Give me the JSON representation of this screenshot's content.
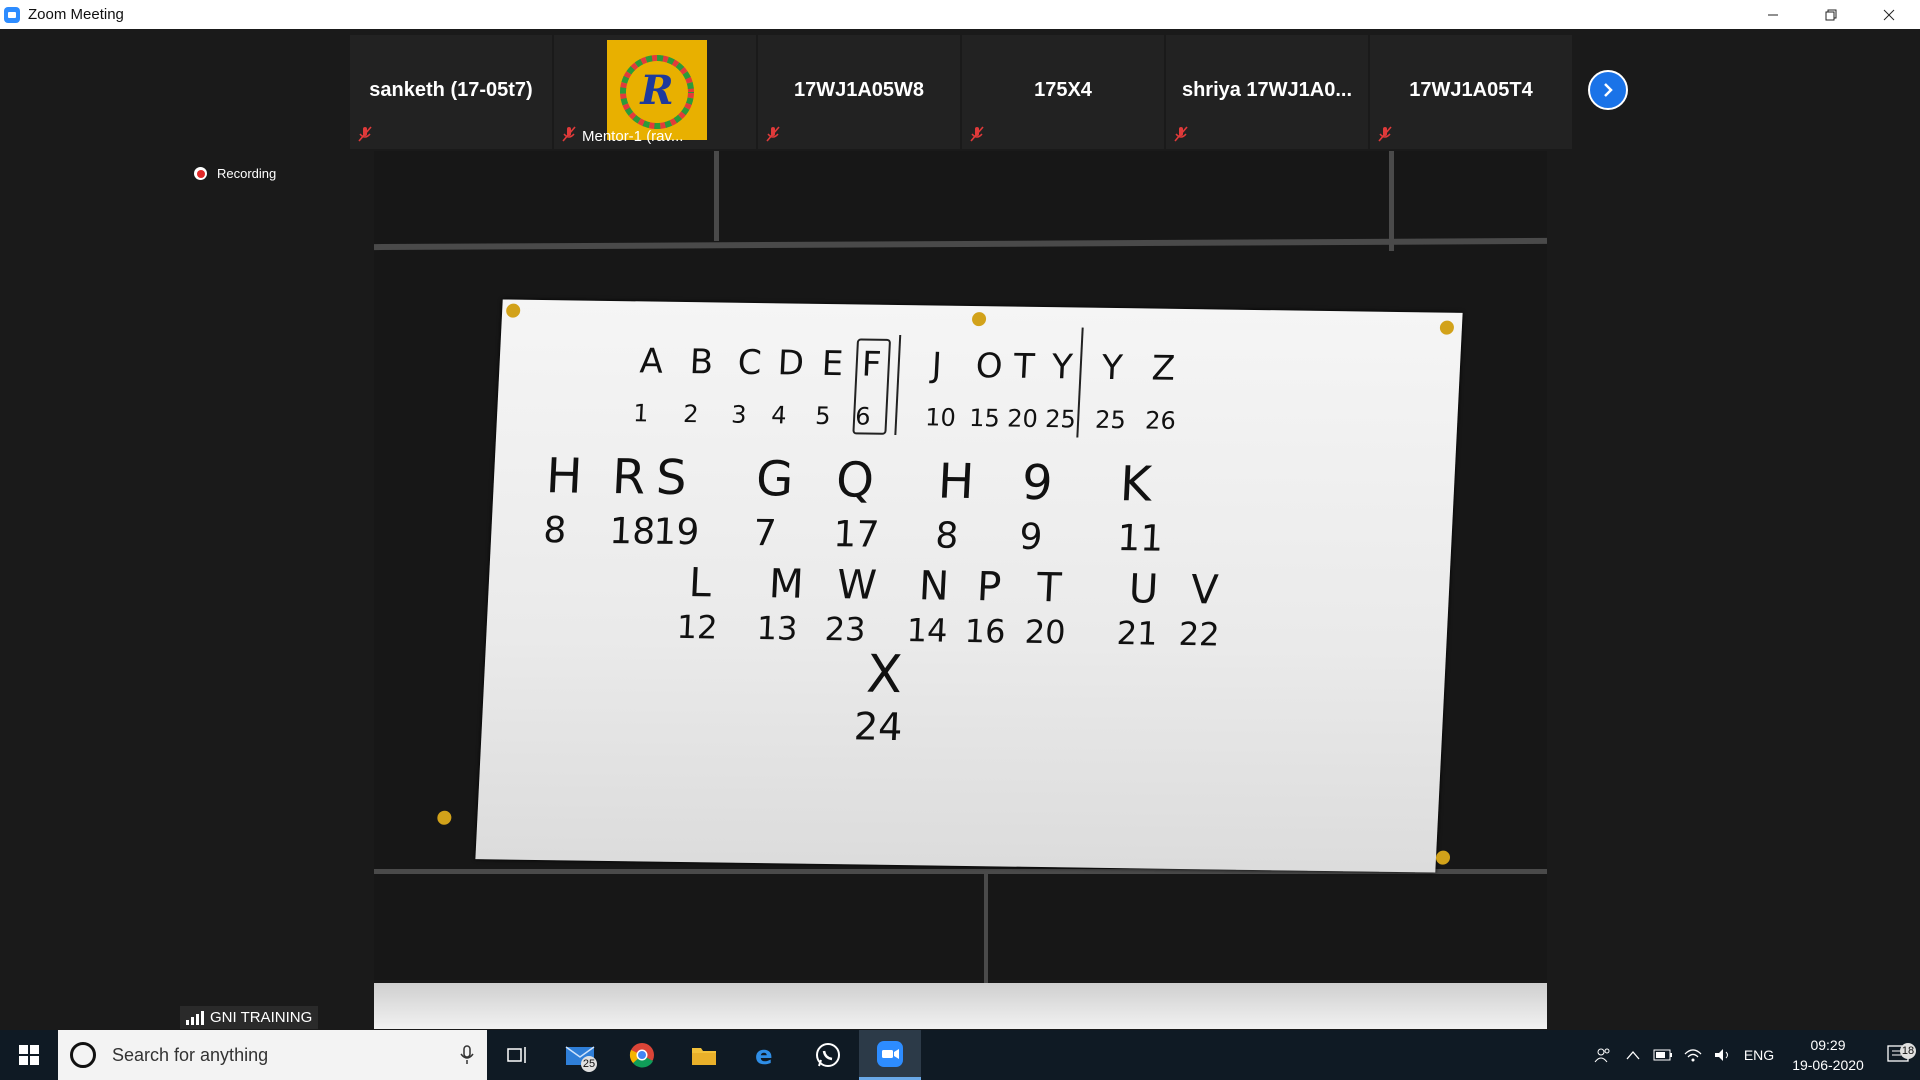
{
  "window": {
    "title": "Zoom Meeting"
  },
  "participants": [
    {
      "name": "sanketh (17-05t7)",
      "muted": true
    },
    {
      "name": "Mentor-1 (rav...",
      "muted": true,
      "has_picture": true,
      "picture_letter": "R"
    },
    {
      "name": "17WJ1A05W8",
      "muted": true
    },
    {
      "name": "175X4",
      "muted": true
    },
    {
      "name": "shriya  17WJ1A0...",
      "muted": true
    },
    {
      "name": "17WJ1A05T4",
      "muted": true
    }
  ],
  "recording": {
    "label": "Recording"
  },
  "shared_video": {
    "board": {
      "row1_letters": [
        "A",
        "B",
        "C",
        "D",
        "E",
        "F",
        "J",
        "O",
        "T",
        "Y",
        "Y",
        "Z"
      ],
      "row1_numbers": [
        "1",
        "2",
        "3",
        "4",
        "5",
        "6",
        "10",
        "15",
        "20",
        "25",
        "25",
        "26"
      ],
      "row2_letters": [
        "H",
        "R",
        "S",
        "G",
        "Q",
        "H",
        "9",
        "K"
      ],
      "row2_numbers": [
        "8",
        "18",
        "19",
        "7",
        "17",
        "8",
        "9",
        "11"
      ],
      "row3_letters": [
        "L",
        "M",
        "W",
        "N",
        "P",
        "T",
        "U",
        "V"
      ],
      "row3_numbers": [
        "12",
        "13",
        "23",
        "14",
        "16",
        "20",
        "21",
        "22"
      ],
      "row4_letter": "X",
      "row4_number": "24"
    }
  },
  "network": {
    "label": "GNI TRAINING"
  },
  "taskbar": {
    "search_placeholder": "Search for anything",
    "mail_badge": "25",
    "language": "ENG",
    "time": "09:29",
    "date": "19-06-2020",
    "notification_count": "18"
  },
  "colors": {
    "accent": "#2d8cff",
    "next_button": "#1a73e8",
    "recording": "#e02828",
    "taskbar": "#0f1a24"
  }
}
